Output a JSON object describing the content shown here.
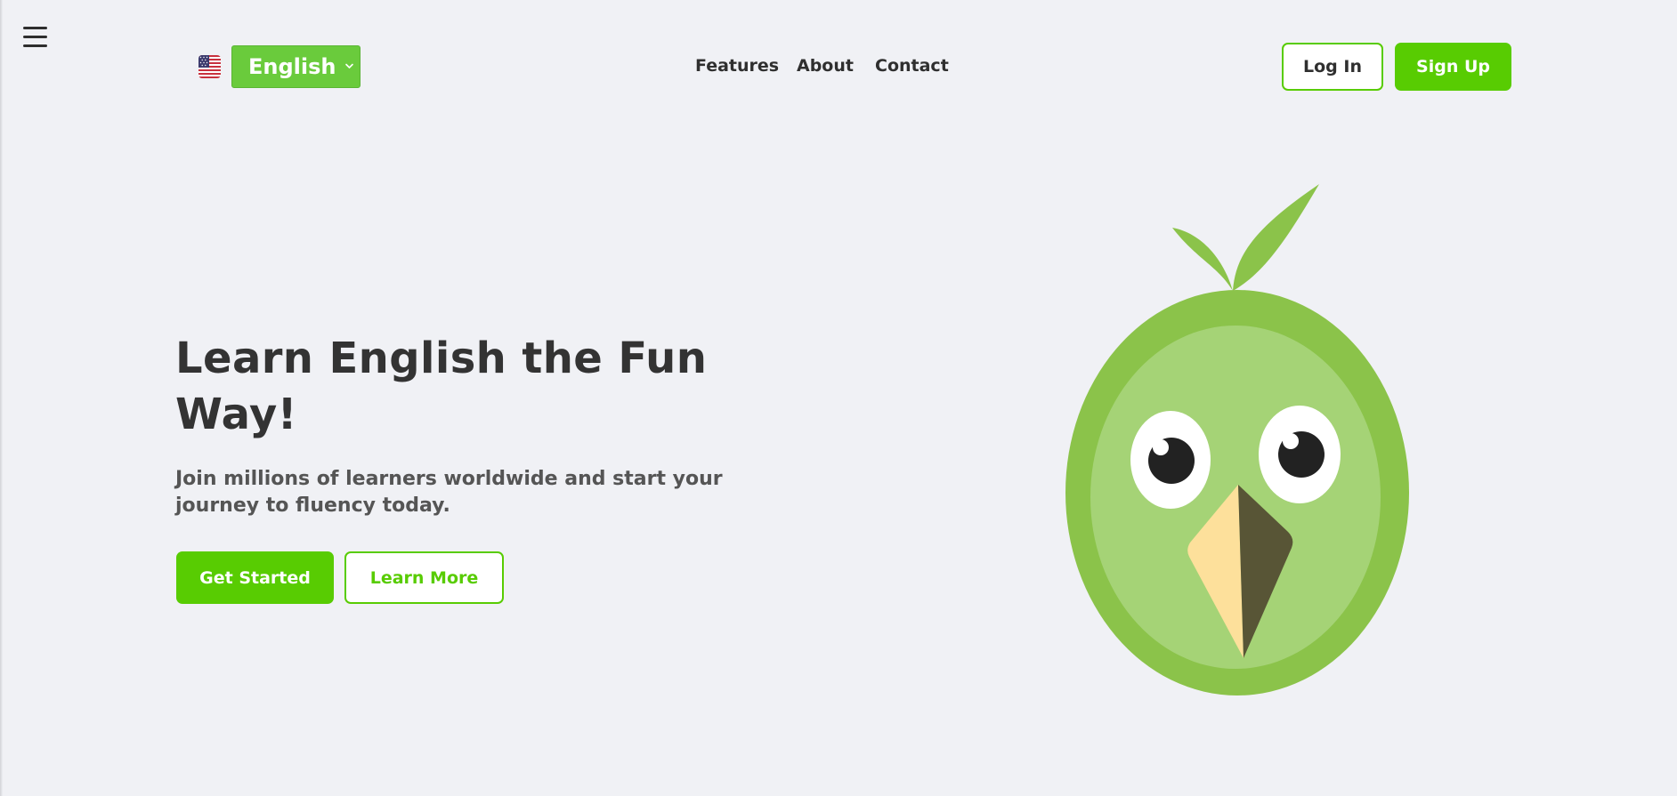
{
  "header": {
    "menu_icon": "hamburger-menu-icon",
    "language": {
      "flag_icon": "us-flag-icon",
      "selected": "English",
      "chevron_icon": "chevron-down-icon"
    },
    "nav": {
      "features": "Features",
      "about": "About",
      "contact": "Contact"
    },
    "auth": {
      "login_label": "Log In",
      "signup_label": "Sign Up"
    }
  },
  "hero": {
    "title": "Learn English the Fun Way!",
    "subtitle": "Join millions of learners worldwide and start your journey to fluency today.",
    "primary_cta": "Get Started",
    "secondary_cta": "Learn More",
    "illustration": "bird-mascot-icon"
  },
  "colors": {
    "background": "#f0f1f5",
    "brand_green": "#58cc02",
    "language_select_green": "#6acb3c",
    "mascot_body_outer": "#8bc34a",
    "mascot_body_inner": "#a5d376",
    "mascot_beak_light": "#fde09b",
    "mascot_beak_dark": "#585536",
    "text_dark": "#333333",
    "text_muted": "#555555"
  }
}
